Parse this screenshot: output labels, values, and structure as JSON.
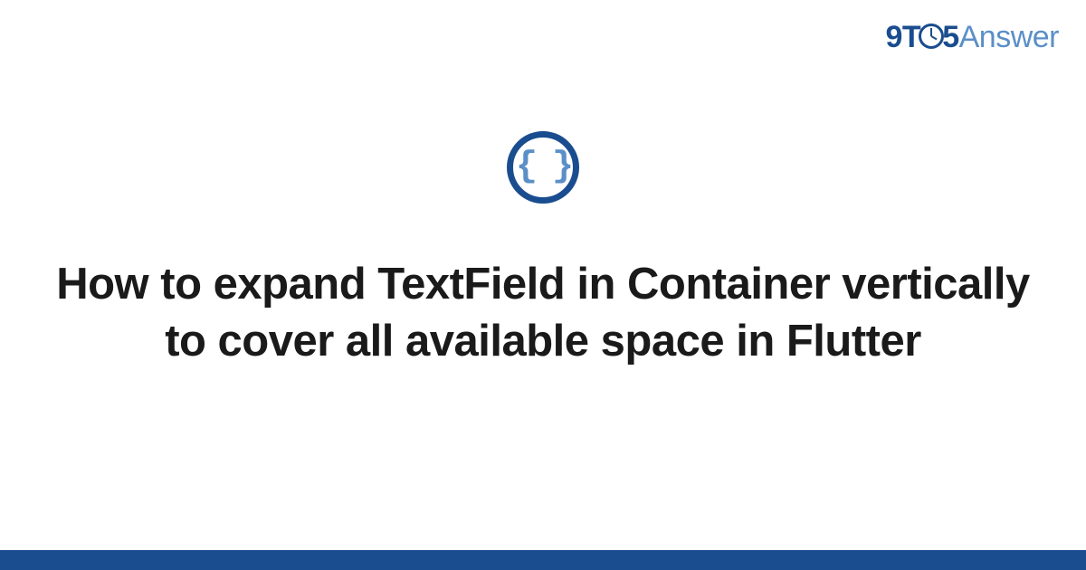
{
  "logo": {
    "nine": "9",
    "t": "T",
    "five": "5",
    "answer": "Answer"
  },
  "icon": {
    "braces": "{ }"
  },
  "title": "How to expand TextField in Container vertically to cover all available space in Flutter"
}
